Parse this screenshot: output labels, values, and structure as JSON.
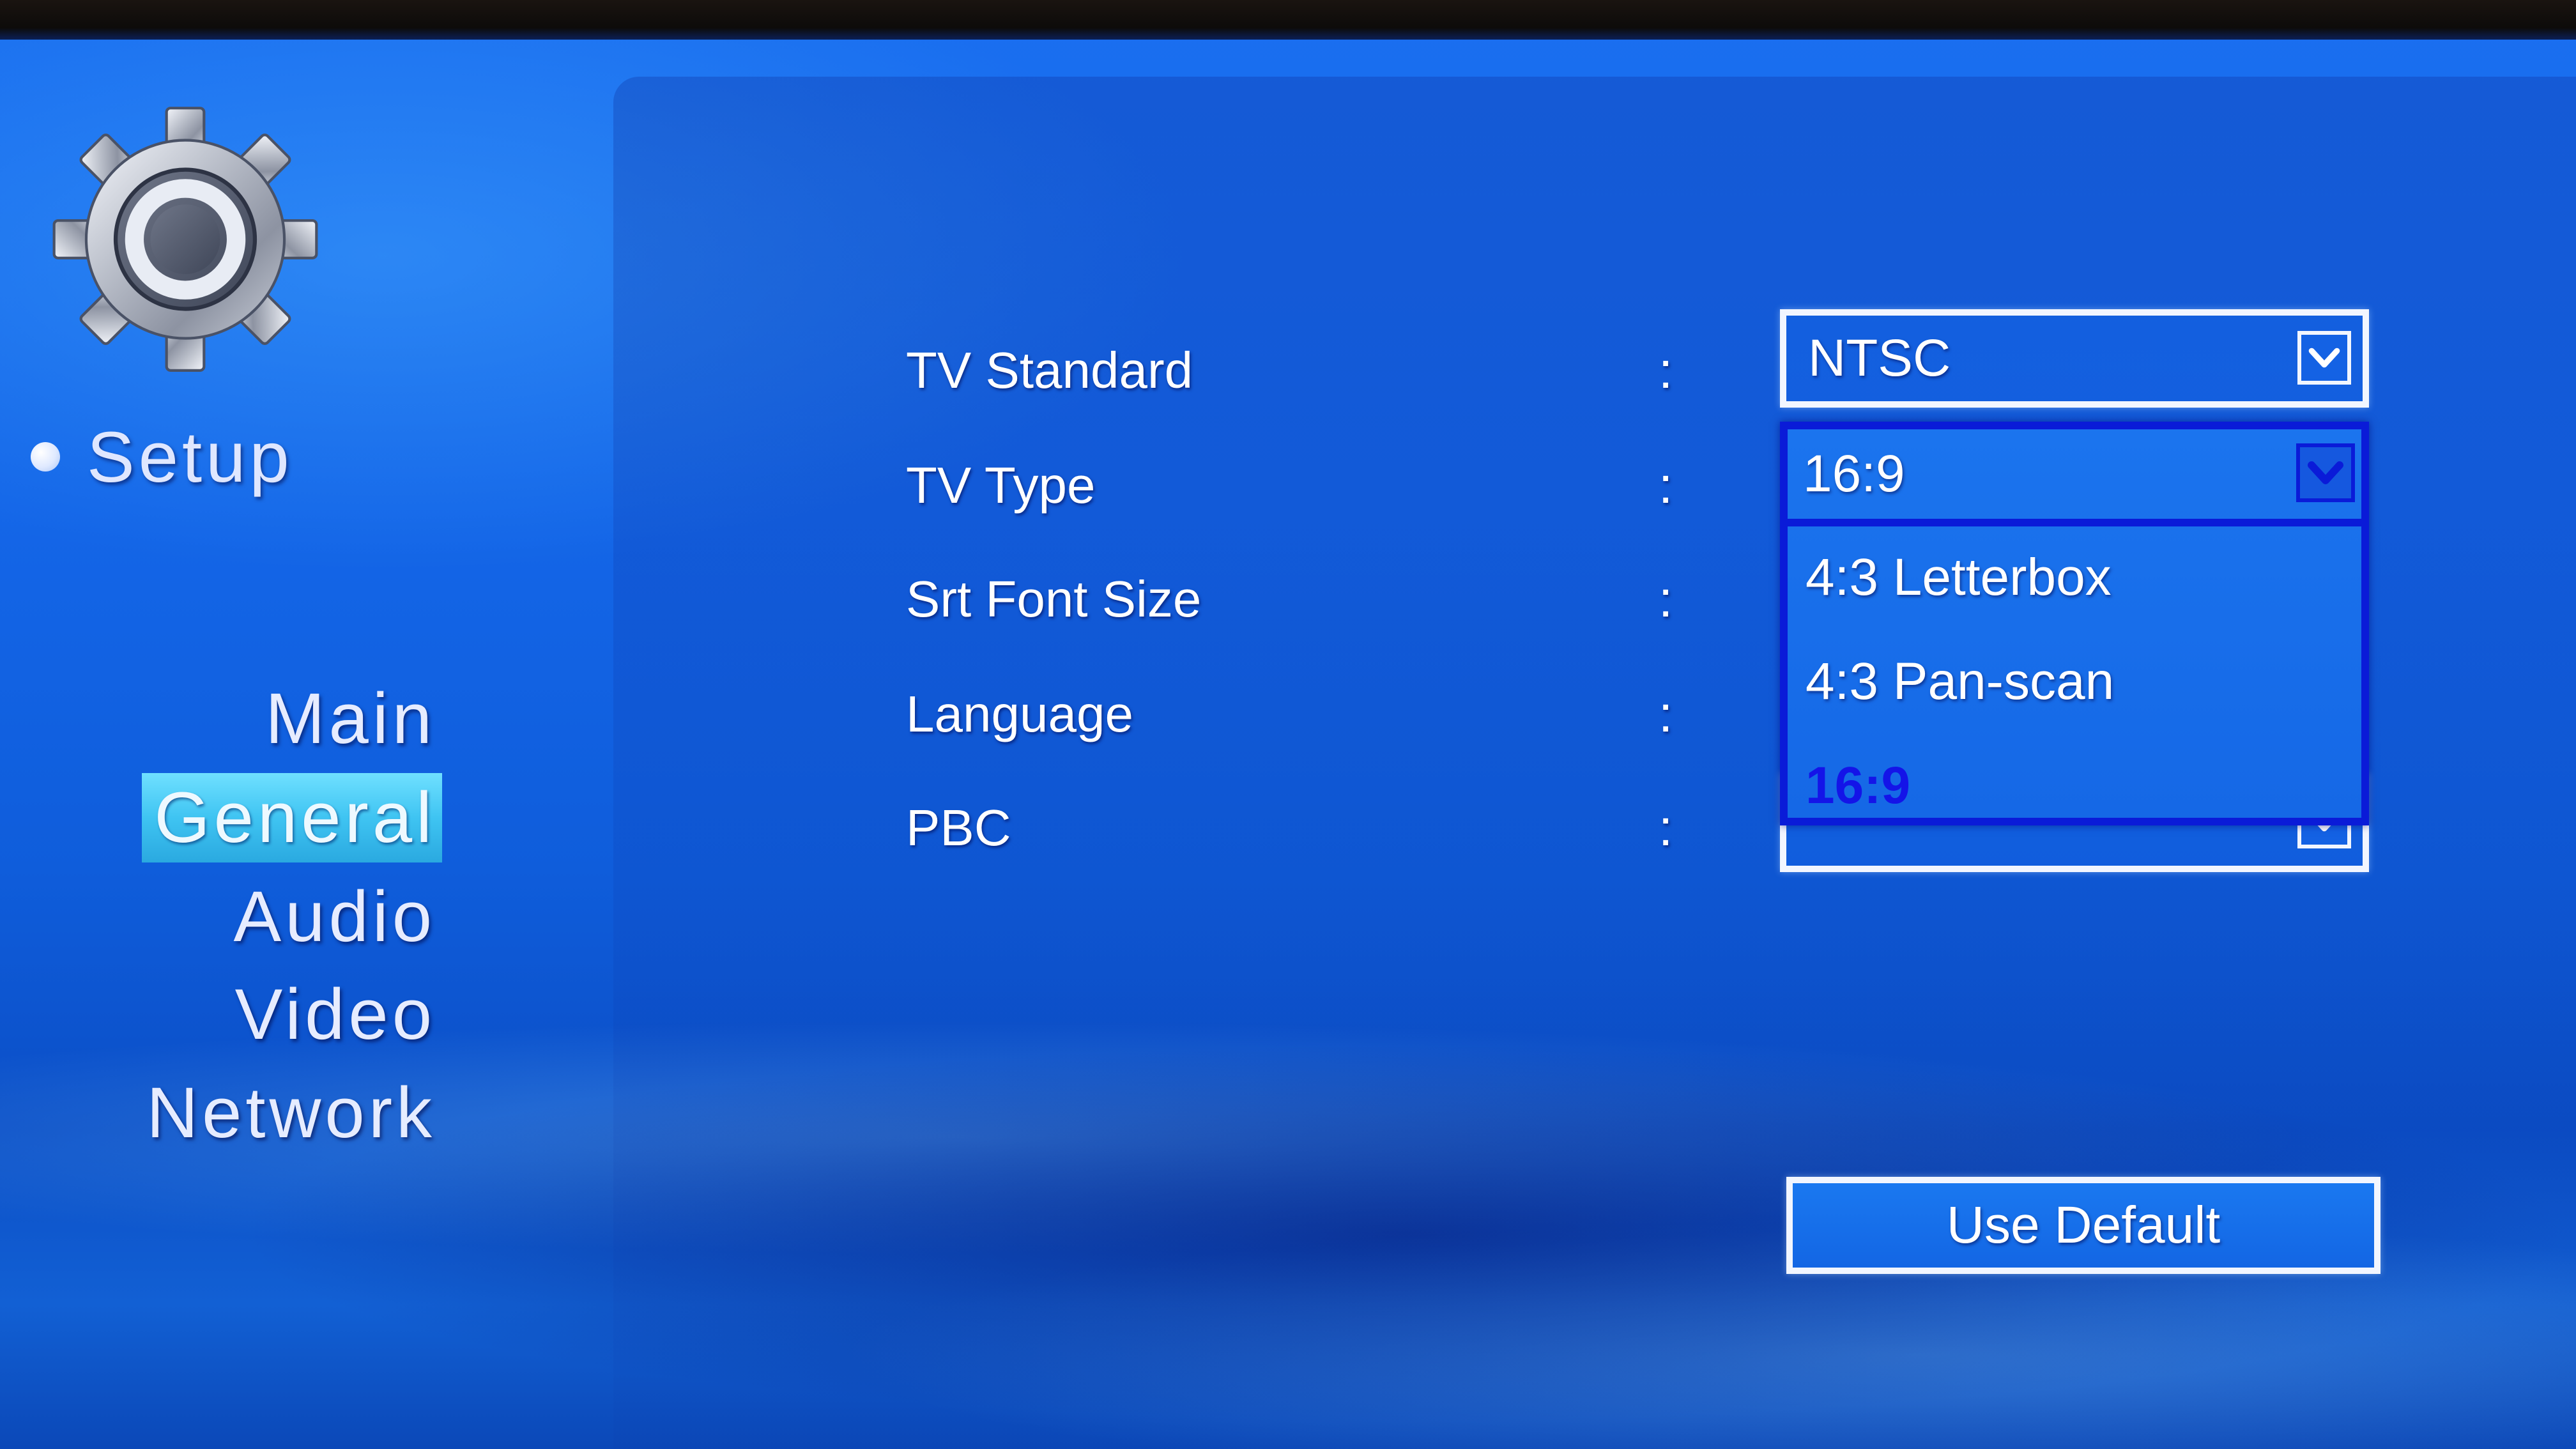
{
  "setup": {
    "title": "Setup",
    "icon": "gear-icon"
  },
  "menu": {
    "items": [
      {
        "label": "Main",
        "selected": false
      },
      {
        "label": "General",
        "selected": true
      },
      {
        "label": "Audio",
        "selected": false
      },
      {
        "label": "Video",
        "selected": false
      },
      {
        "label": "Network",
        "selected": false
      }
    ]
  },
  "settings": {
    "colon": ":",
    "rows": [
      {
        "label": "TV Standard",
        "value": "NTSC"
      },
      {
        "label": "TV Type",
        "value": "16:9"
      },
      {
        "label": "Srt Font Size",
        "value": ""
      },
      {
        "label": "Language",
        "value": ""
      },
      {
        "label": "PBC",
        "value": ""
      }
    ]
  },
  "tv_type_dropdown": {
    "open": true,
    "current": "16:9",
    "options": [
      "4:3 Letterbox",
      "4:3 Pan-scan",
      "16:9"
    ],
    "highlighted_option": "16:9"
  },
  "buttons": {
    "use_default": "Use Default"
  },
  "colors": {
    "background": "#1466e8",
    "menu_highlight": "#3fc4f2",
    "dropdown_border": "#0a1bd8",
    "highlighted_option_text": "#1414e8",
    "text": "#ffffff"
  }
}
